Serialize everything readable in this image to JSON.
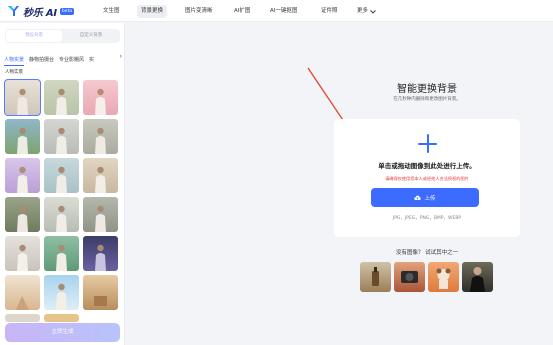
{
  "brand": {
    "name": "秒乐 AI",
    "badge": "beta"
  },
  "nav": {
    "items": [
      "文生图",
      "背景更换",
      "图片变清晰",
      "AI扩图",
      "AI一键抠图",
      "证件照",
      "更多"
    ],
    "active_index": 1
  },
  "sidebar": {
    "segments": [
      "预设背景",
      "自定义背景"
    ],
    "categories": [
      "人物实景",
      "静物拍摄台",
      "专业影棚风",
      "实"
    ],
    "section_title": "人物实景",
    "generate_label": "立即生成"
  },
  "main": {
    "title": "智能更换背景",
    "subtitle": "在几秒钟内删除和更改图片背景。",
    "upload_prompt": "单击或拖动图像到此处进行上传。",
    "upload_warning": "请确保仅使用您本人或经他人合法授权的图片",
    "upload_button": "上传",
    "formats": "JPG，JPEG，PNG，BMP，WEBP",
    "no_image_prompt": "没有图像？ 试试其中之一"
  },
  "colors": {
    "accent": "#3b6cff",
    "warning": "#e23b3b",
    "arrow": "#e2452e"
  }
}
